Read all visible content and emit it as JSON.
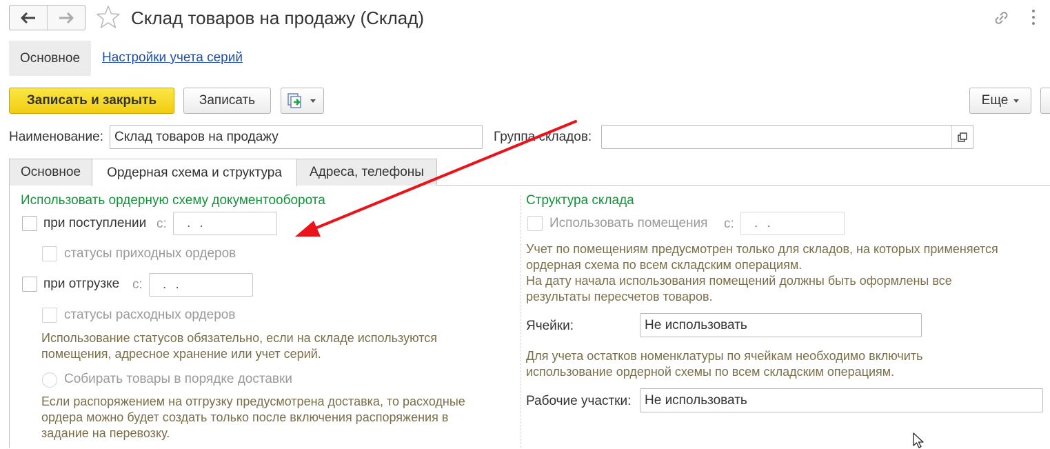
{
  "window": {
    "title": "Склад товаров на продажу (Склад)"
  },
  "sections": {
    "main": "Основное",
    "series_link": "Настройки учета серий"
  },
  "toolbar": {
    "save_close": "Записать и закрыть",
    "save": "Записать",
    "more": "Еще"
  },
  "form": {
    "name_label": "Наименование:",
    "name_value": "Склад товаров на продажу",
    "group_label": "Группа складов:",
    "group_value": ""
  },
  "tabs": [
    "Основное",
    "Ордерная схема и структура",
    "Адреса, телефоны"
  ],
  "order_scheme": {
    "title": "Использовать ордерную схему документооборота",
    "receipt_label": "при поступлении",
    "receipt_date_prefix": "с:",
    "receipt_date": ". .",
    "receipt_statuses": "статусы приходных ордеров",
    "shipment_label": "при отгрузке",
    "shipment_date_prefix": "с:",
    "shipment_date": ". .",
    "shipment_statuses": "статусы расходных ордеров",
    "statuses_note_1": "Использование статусов обязательно, если на складе используются",
    "statuses_note_2": "помещения, адресное хранение или учет серий.",
    "delivery_order": "Собирать товары в порядке доставки",
    "delivery_note_1": "Если распоряжением на отгрузку предусмотрена доставка, то расходные",
    "delivery_note_2": "ордера можно будет создать только после включения распоряжения в",
    "delivery_note_3": "задание на перевозку."
  },
  "structure": {
    "title": "Структура склада",
    "use_rooms": "Использовать помещения",
    "rooms_date_prefix": "с:",
    "rooms_date": ". .",
    "rooms_note_1": "Учет по помещениям предусмотрен только для складов, на которых применяется",
    "rooms_note_2": "ордерная схема по всем складским операциям.",
    "rooms_note_3": "На дату начала использования помещений должны быть оформлены все",
    "rooms_note_4": "результаты пересчетов товаров.",
    "cells_label": "Ячейки:",
    "cells_value": "Не использовать",
    "cells_note_1": "Для учета остатков номенклатуры по ячейкам необходимо включить",
    "cells_note_2": "использование ордерной схемы по всем складским операциям.",
    "work_areas_label": "Рабочие участки:",
    "work_areas_value": "Не использовать"
  },
  "colors": {
    "accent_yellow": "#f5d61c",
    "section_green": "#15913a",
    "note_text": "#7a6f4a",
    "link_blue": "#1f4fa8",
    "annotation_red": "#e8131b"
  },
  "icons": [
    "back-arrow-icon",
    "forward-arrow-icon",
    "favorite-star-icon",
    "link-icon",
    "more-vertical-icon",
    "report-icon",
    "open-form-icon",
    "annotation-arrow",
    "mouse-cursor-icon"
  ]
}
